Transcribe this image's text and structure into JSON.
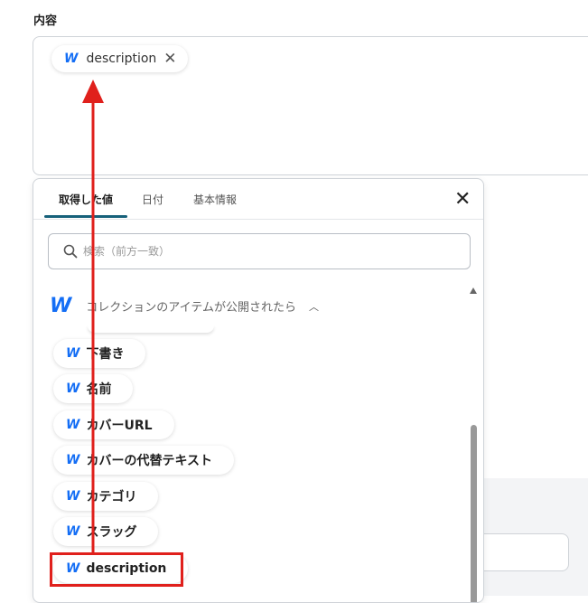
{
  "field": {
    "label": "内容"
  },
  "content_tag": {
    "text": "description",
    "remove_symbol": "✕"
  },
  "popup": {
    "tabs": [
      {
        "label": "取得した値"
      },
      {
        "label": "日付"
      },
      {
        "label": "基本情報"
      }
    ],
    "close_symbol": "✕",
    "search": {
      "placeholder": "検索（前方一致）"
    },
    "group": {
      "title": "コレクションのアイテムが公開されたら",
      "caret": "︿"
    },
    "items": [
      {
        "label": "下書き"
      },
      {
        "label": "名前"
      },
      {
        "label": "カバーURL"
      },
      {
        "label": "カバーの代替テキスト"
      },
      {
        "label": "カテゴリ"
      },
      {
        "label": "スラッグ"
      },
      {
        "label": "description"
      }
    ]
  },
  "icons": {
    "webflow_logo": "webflow-logo-icon",
    "search": "search-icon",
    "close": "close-icon",
    "caret": "chevron-up-icon"
  },
  "colors": {
    "accent": "#146ef5",
    "tab_underline": "#16617a",
    "annotation": "#e0201c"
  }
}
